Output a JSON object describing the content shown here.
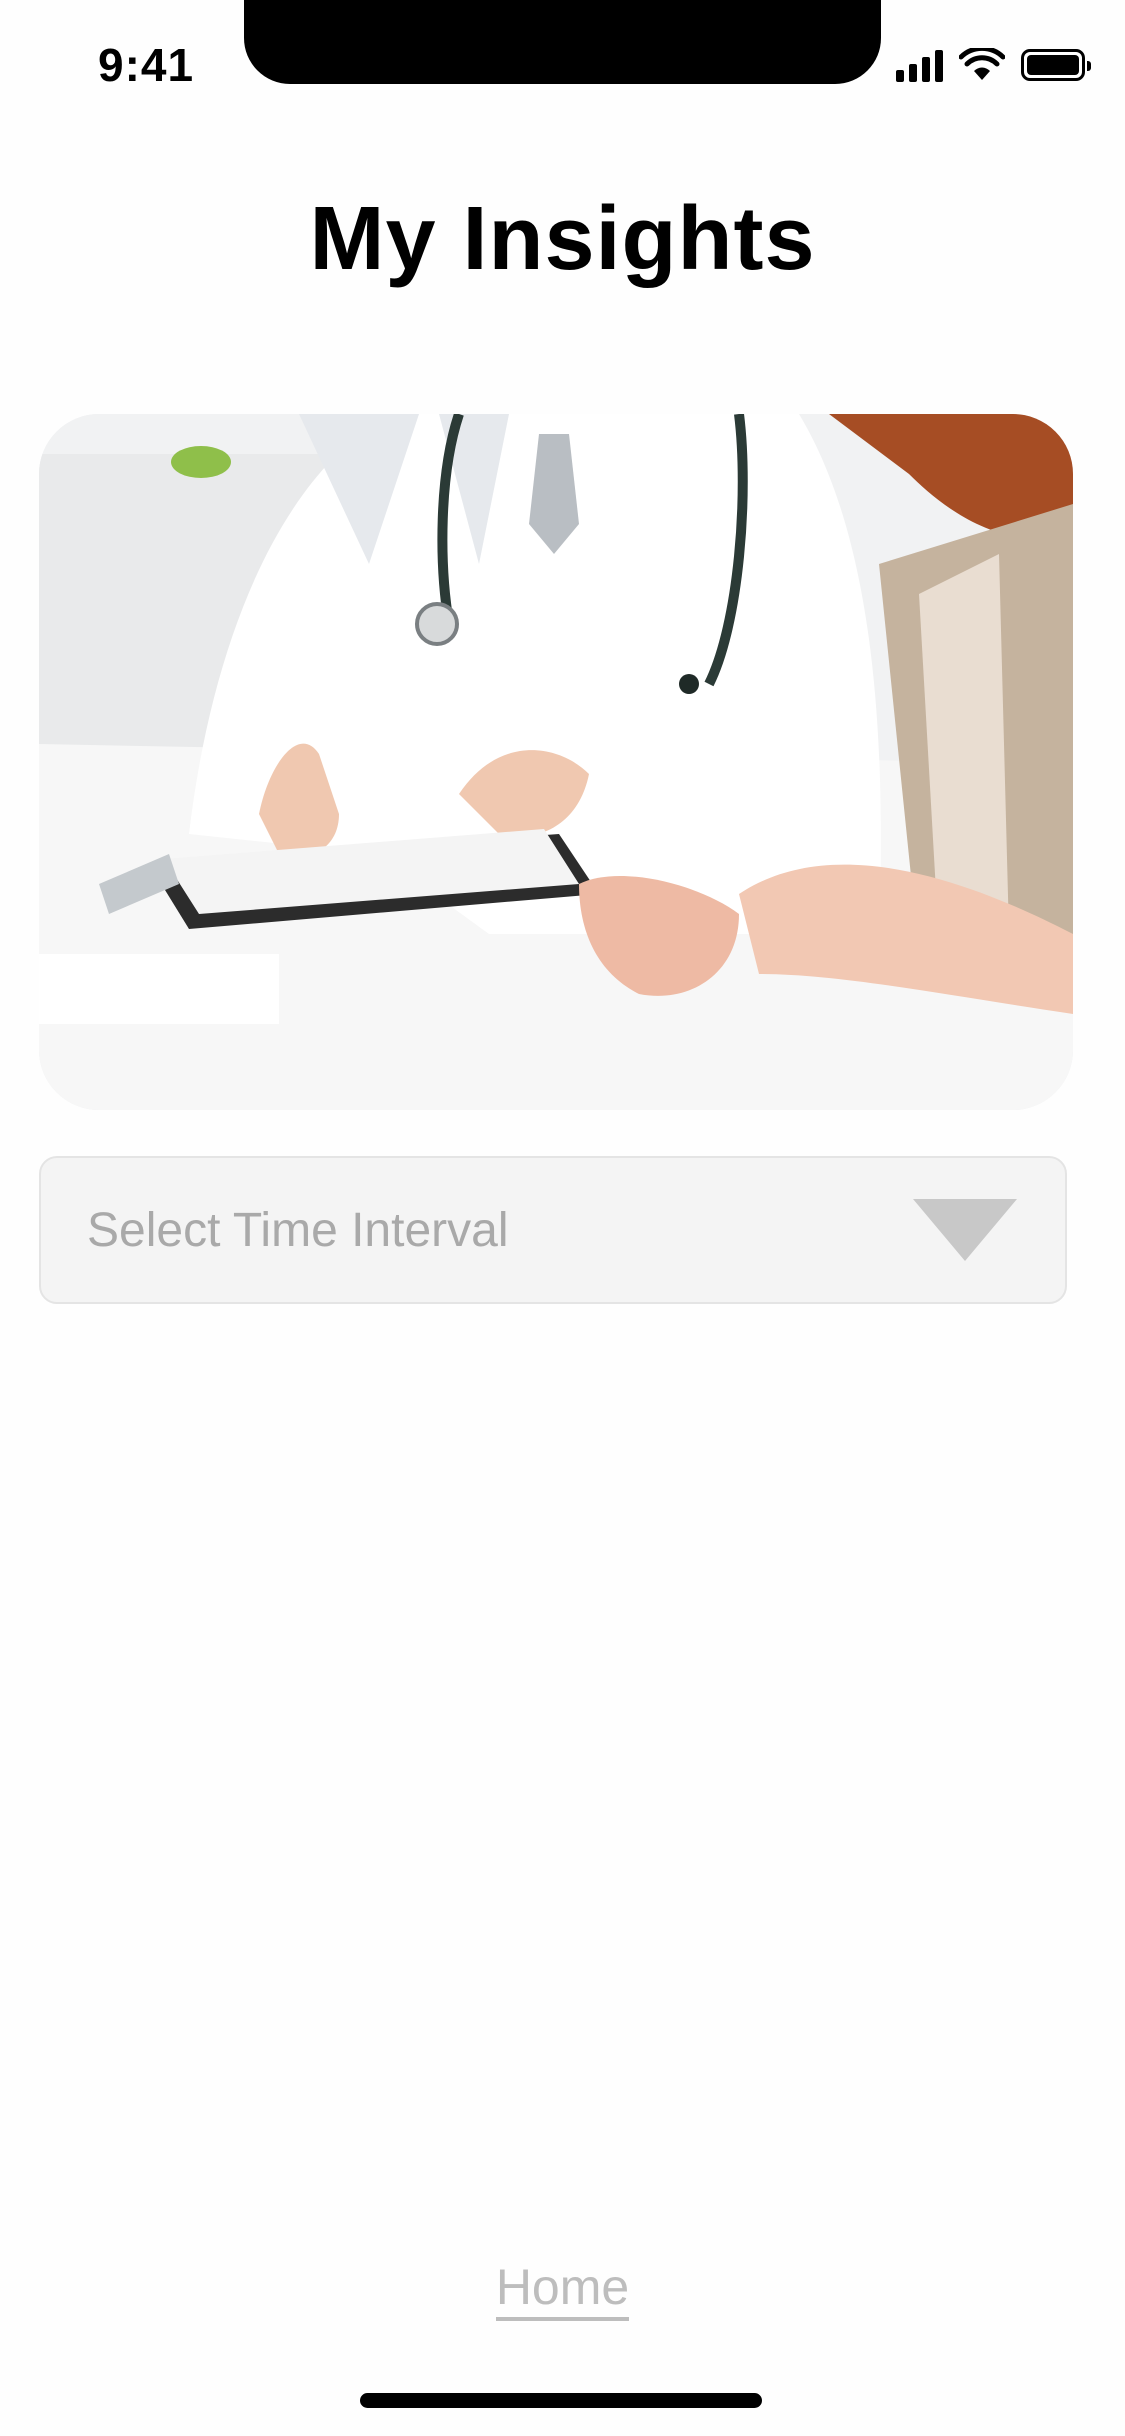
{
  "status_bar": {
    "time": "9:41",
    "icons": [
      "cellular-signal-icon",
      "wifi-icon",
      "battery-icon"
    ]
  },
  "header": {
    "title": "My Insights"
  },
  "hero": {
    "image": "doctor-patient-consultation-photo"
  },
  "time_interval_select": {
    "placeholder": "Select Time Interval",
    "icon": "dropdown-triangle-icon"
  },
  "footer": {
    "home_label": "Home"
  },
  "colors": {
    "placeholder_text": "#a9a9a9",
    "select_background": "#f4f4f4",
    "link_text": "#bdbdbd"
  }
}
